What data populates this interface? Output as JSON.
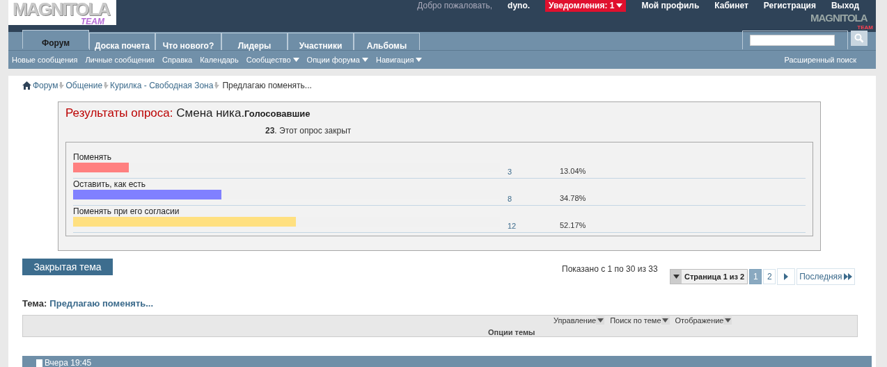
{
  "header": {
    "logo": {
      "word": "MAGNITOLA",
      "tag": "TEAM"
    },
    "welcome": "Добро пожаловать,",
    "user": "dyno",
    "user_suffix": ".",
    "notifications": "Уведомления: 1",
    "links": [
      "Мой профиль",
      "Кабинет",
      "Регистрация",
      "Выход"
    ],
    "small_logo": {
      "word": "MAGNITOLA",
      "tag": "TEAM"
    }
  },
  "tabs": [
    {
      "label": "Форум",
      "selected": true
    },
    {
      "label": "Доска почета",
      "selected": false
    },
    {
      "label": "Что нового?",
      "selected": false
    },
    {
      "label": "Лидеры",
      "selected": false
    },
    {
      "label": "Участники",
      "selected": false
    },
    {
      "label": "Альбомы",
      "selected": false
    }
  ],
  "subnav": [
    {
      "label": "Новые сообщения",
      "dropdown": false
    },
    {
      "label": "Личные сообщения",
      "dropdown": false
    },
    {
      "label": "Справка",
      "dropdown": false
    },
    {
      "label": "Календарь",
      "dropdown": false
    },
    {
      "label": "Сообщество",
      "dropdown": true
    },
    {
      "label": "Опции форума",
      "dropdown": true
    },
    {
      "label": "Навигация",
      "dropdown": true
    }
  ],
  "advanced_search": "Расширенный поиск",
  "breadcrumbs": [
    "Форум",
    "Общение",
    "Курилка - Свободная Зона"
  ],
  "breadcrumb_current": "Предлагаю поменять...",
  "poll": {
    "heading": "Результаты опроса:",
    "question": "Смена ника.",
    "voters_label": "Голосовавшие",
    "voters": "23",
    "status": ". Этот опрос закрыт",
    "options": [
      {
        "label": "Поменять",
        "votes": "3",
        "percent": "13.04%",
        "level": 0.1304,
        "color": "#ff8080"
      },
      {
        "label": "Оставить, как есть",
        "votes": "8",
        "percent": "34.78%",
        "level": 0.3478,
        "color": "#8080ff"
      },
      {
        "label": "Поменять при его согласии",
        "votes": "12",
        "percent": "52.17%",
        "level": 0.5217,
        "color": "#ffe080"
      }
    ]
  },
  "closed_button": "Закрытая тема",
  "shown": "Показано с 1 по 30 из 33",
  "pagination": {
    "page_of": "Страница 1 из 2",
    "pages": [
      {
        "label": "1",
        "selected": true
      },
      {
        "label": "2",
        "selected": false
      }
    ],
    "last": "Последняя"
  },
  "thread": {
    "label": "Тема:",
    "title": "Предлагаю поменять..."
  },
  "thread_tools": {
    "menus": [
      "Управление",
      "Поиск по теме",
      "Отображение"
    ],
    "title": "Опции темы"
  },
  "post_bar": {
    "date": "Вчера 19:45"
  }
}
